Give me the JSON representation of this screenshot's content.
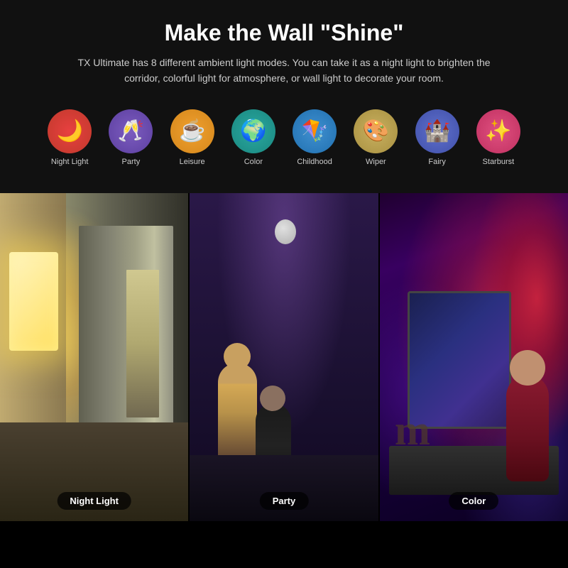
{
  "header": {
    "title": "Make the Wall \"Shine\"",
    "subtitle": "TX Ultimate has 8 different ambient light modes. You can take it as a night light to brighten the corridor, colorful light for atmosphere, or wall light to decorate your room."
  },
  "modes": [
    {
      "id": "nightlight",
      "label": "Night Light",
      "icon": "🌙",
      "circle_class": "circle-nightlight"
    },
    {
      "id": "party",
      "label": "Party",
      "icon": "🥂",
      "circle_class": "circle-party"
    },
    {
      "id": "leisure",
      "label": "Leisure",
      "icon": "☕",
      "circle_class": "circle-leisure"
    },
    {
      "id": "color",
      "label": "Color",
      "icon": "🌍",
      "circle_class": "circle-color"
    },
    {
      "id": "childhood",
      "label": "Childhood",
      "icon": "🪁",
      "circle_class": "circle-childhood"
    },
    {
      "id": "wiper",
      "label": "Wiper",
      "icon": "🎨",
      "circle_class": "circle-wiper"
    },
    {
      "id": "fairy",
      "label": "Fairy",
      "icon": "🏰",
      "circle_class": "circle-fairy"
    },
    {
      "id": "starburst",
      "label": "Starburst",
      "icon": "✨",
      "circle_class": "circle-starburst"
    }
  ],
  "panels": [
    {
      "id": "nightlight",
      "label": "Night Light"
    },
    {
      "id": "party",
      "label": "Party"
    },
    {
      "id": "color",
      "label": "Color"
    }
  ]
}
